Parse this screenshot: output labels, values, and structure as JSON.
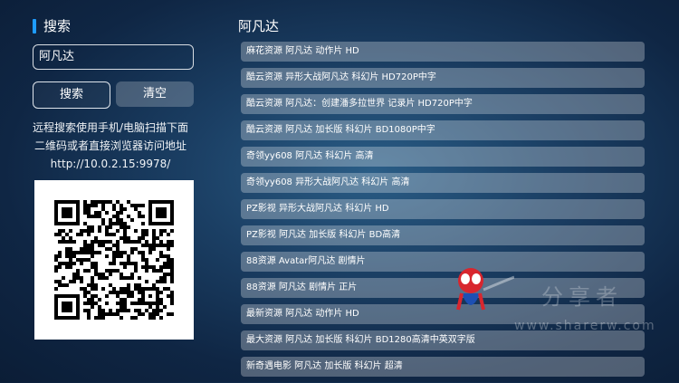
{
  "left_panel": {
    "title": "搜索",
    "search_value": "阿凡达",
    "search_button": "搜索",
    "clear_button": "清空",
    "hint_lines": [
      "远程搜索使用手机/电脑扫描下面",
      "二维码或者直接浏览器访问地址",
      "http://10.0.2.15:9978/"
    ]
  },
  "results": {
    "title": "阿凡达",
    "items": [
      "麻花资源 阿凡达 动作片 HD",
      "酷云资源 异形大战阿凡达 科幻片 HD720P中字",
      "酷云资源 阿凡达：创建潘多拉世界 记录片 HD720P中字",
      "酷云资源 阿凡达 加长版 科幻片 BD1080P中字",
      "奇领yy608 阿凡达 科幻片 高清",
      "奇领yy608 异形大战阿凡达 科幻片 高清",
      "PZ影视 异形大战阿凡达 科幻片 HD",
      "PZ影视 阿凡达 加长版 科幻片 BD高清",
      "88资源 Avatar阿凡达 剧情片",
      "88资源 阿凡达 剧情片 正片",
      "最新资源 阿凡达 动作片 HD",
      "最大资源 阿凡达 加长版 科幻片 BD1280高清中英双字版",
      "新奇遇电影 阿凡达 加长版 科幻片 超清"
    ]
  },
  "watermark": {
    "text": "分享者",
    "url": "www.sharerw.com"
  },
  "colors": {
    "accent": "#1e9cff",
    "background": "#1b3f64"
  }
}
